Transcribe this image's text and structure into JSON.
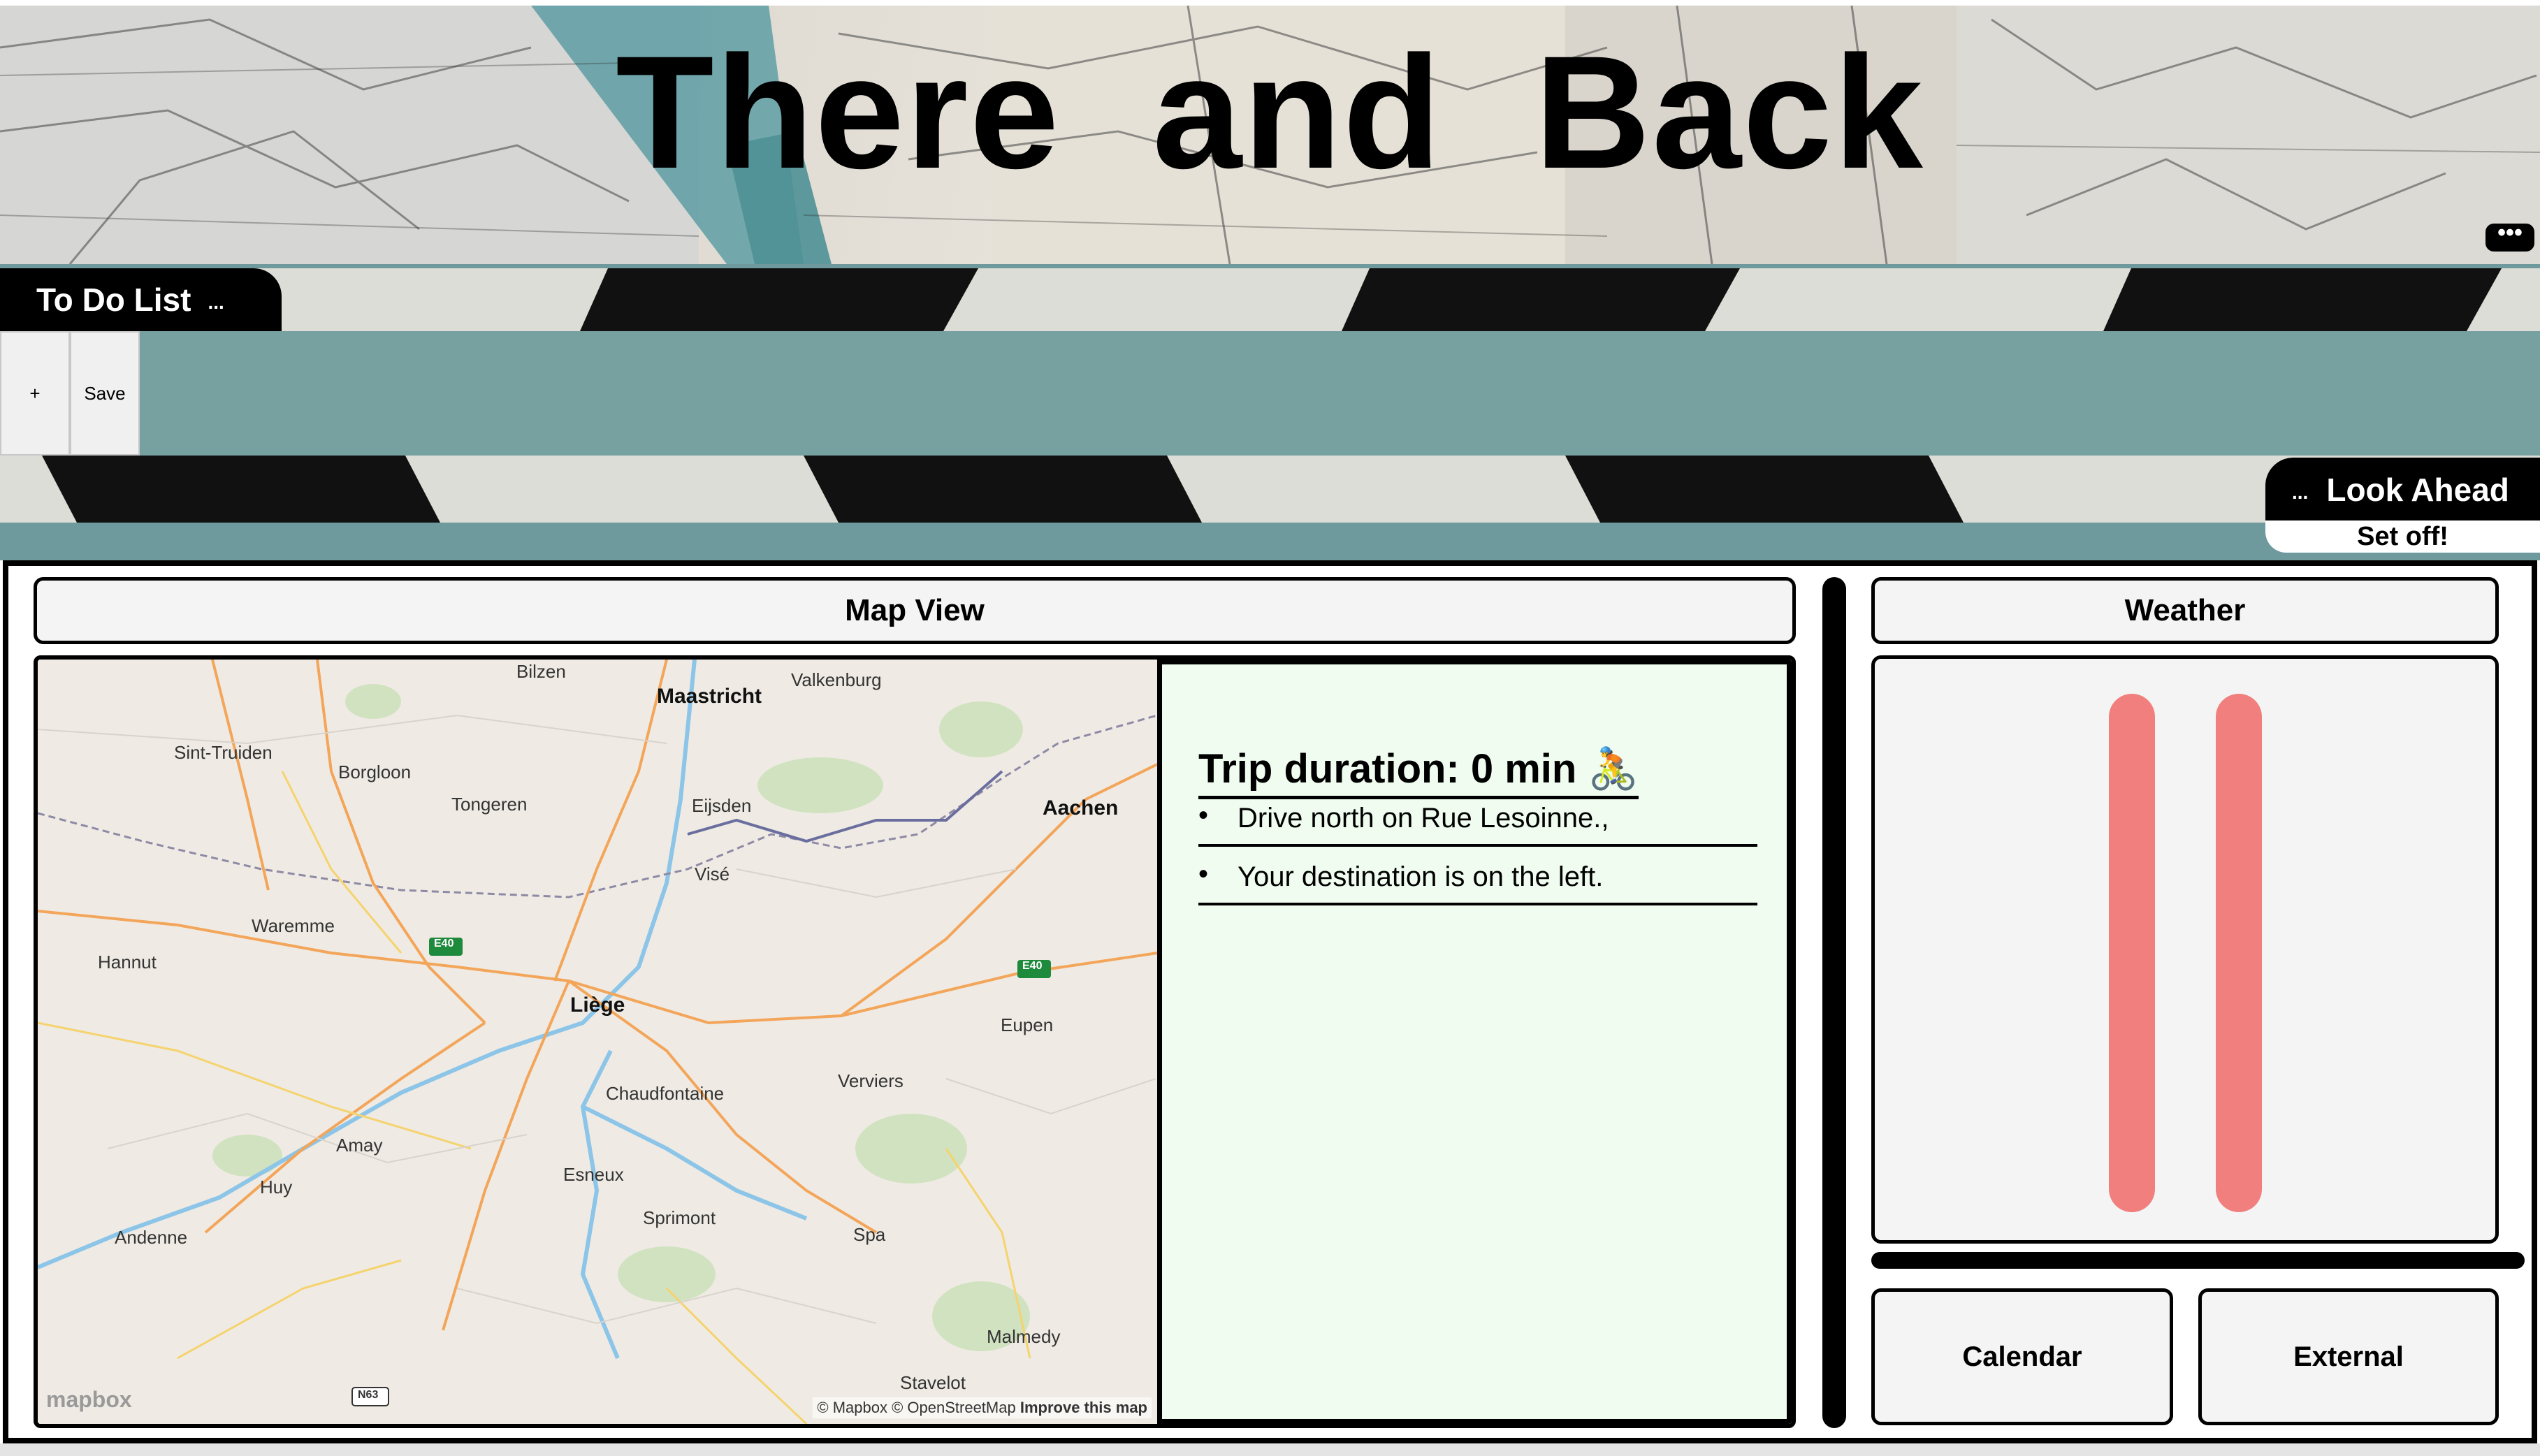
{
  "header": {
    "title": "There  and  Back",
    "menu_label": "•••"
  },
  "todo": {
    "tab_label": "To Do List",
    "tab_dots": "...",
    "add_label": "+",
    "save_label": "Save"
  },
  "look_ahead": {
    "tab_dots": "...",
    "tab_label": "Look Ahead",
    "status": "Set off!"
  },
  "map_view": {
    "heading": "Map View",
    "place_labels": [
      "Bilzen",
      "Maastricht",
      "Valkenburg",
      "Sint-Truiden",
      "Borgloon",
      "Tongeren",
      "Eijsden",
      "Aachen",
      "Visé",
      "Waremme",
      "E40",
      "E40",
      "Hannut",
      "Liège",
      "Eupen",
      "Chaudfontaine",
      "Verviers",
      "Amay",
      "Huy",
      "Esneux",
      "Sprimont",
      "Andenne",
      "Spa",
      "Malmedy",
      "Stavelot",
      "N63"
    ],
    "logo": "mapbox",
    "attribution": "© Mapbox © OpenStreetMap",
    "improve_link": "Improve this map"
  },
  "directions": {
    "trip_title": "Trip duration: 0 min 🚴",
    "steps": [
      "Drive north on Rue Lesoinne.,",
      "Your destination is on the left."
    ]
  },
  "weather": {
    "heading": "Weather",
    "bar_color": "#f07f7d"
  },
  "buttons": {
    "calendar": "Calendar",
    "external": "External"
  },
  "colors": {
    "teal": "#77a0a0",
    "mint_panel": "#effcef"
  }
}
